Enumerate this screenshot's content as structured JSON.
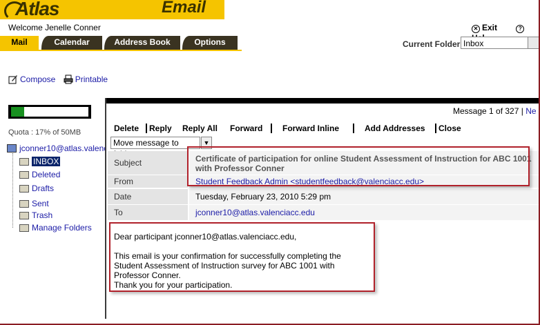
{
  "app": {
    "logo_text": "Atlas",
    "section_title": "Email",
    "welcome": "Welcome Jenelle Conner",
    "exit_label": "Exit",
    "help_label": "Hel"
  },
  "tabs": [
    {
      "label": "Mail",
      "active": true
    },
    {
      "label": "Calendar",
      "active": false
    },
    {
      "label": "Address Book",
      "active": false
    },
    {
      "label": "Options",
      "active": false
    }
  ],
  "current_folder": {
    "label": "Current Folder:",
    "value": "Inbox"
  },
  "actions": {
    "compose": "Compose",
    "printable": "Printable"
  },
  "quota": {
    "text": "Quota : 17% of 50MB",
    "fraction": 0.17
  },
  "folders": {
    "account": "jconner10@atlas.valenc",
    "items": [
      "INBOX",
      "Deleted",
      "Drafts",
      "Sent",
      "Trash",
      "Manage Folders"
    ]
  },
  "message": {
    "counter_text": "Message 1 of 327 |",
    "counter_next": "Ne",
    "toolbar": [
      "Delete",
      "Reply",
      "Reply All",
      "Forward",
      "Forward Inline",
      "Add Addresses",
      "Close"
    ],
    "move_placeholder": "Move message to folder",
    "headers": {
      "subject_label": "Subject",
      "subject_value": "Certificate of participation for online Student Assessment of Instruction for ABC 1001 with Professor Conner",
      "from_label": "From",
      "from_value": "Student Feedback Admin <studentfeedback@valenciacc.edu>",
      "date_label": "Date",
      "date_value": "Tuesday, February 23, 2010 5:29 pm",
      "to_label": "To",
      "to_value": "jconner10@atlas.valenciacc.edu"
    },
    "body": "Dear participant jconner10@atlas.valenciacc.edu,\n\nThis email is your confirmation for successfully completing the Student Assessment of Instruction survey for ABC 1001 with Professor Conner.\nThank you for your participation."
  },
  "colors": {
    "brand_yellow": "#f5c400",
    "tab_dark": "#3a3321",
    "link_blue": "#1a1aa6",
    "highlight_red": "#b0202a",
    "quota_green": "#189020"
  }
}
